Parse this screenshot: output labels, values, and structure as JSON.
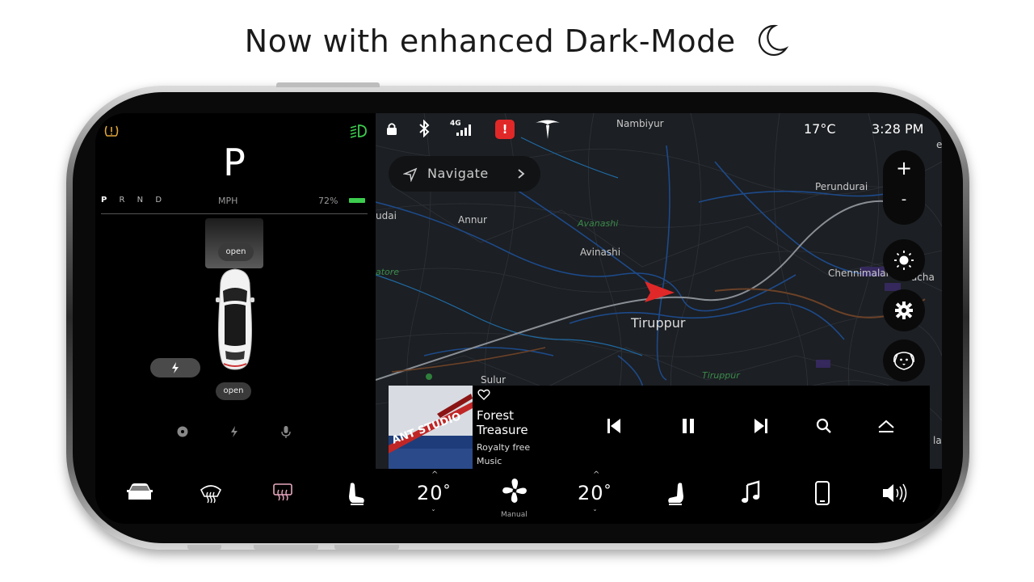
{
  "headline": "Now with enhanced Dark-Mode",
  "left_panel": {
    "gear": "P",
    "gears_rest": "R N D",
    "gear_selected": "P",
    "speed_unit": "MPH",
    "battery_percent": "72%",
    "battery_color": "#3ccd4e",
    "frunk_label": "open",
    "trunk_label": "open",
    "icons": [
      "tire-warning-icon",
      "headlights-icon",
      "charge-port-icon",
      "dashcam-icon",
      "lightning-icon",
      "microphone-icon"
    ]
  },
  "status_bar": {
    "icons": [
      "lock-icon",
      "bluetooth-icon",
      "lte-signal-icon",
      "alert-icon",
      "tesla-logo-icon"
    ],
    "network": "4G",
    "alert_mark": "!",
    "temperature": "17°C",
    "time": "3:28 PM"
  },
  "map": {
    "navigate_label": "Navigate",
    "zoom_in": "+",
    "zoom_out": "-",
    "places": {
      "nambiyur": "Nambiyur",
      "perundurai": "Perundurai",
      "annur": "Annur",
      "avanashi": "Avanashi",
      "avinashi": "Avinashi",
      "chennimalai": "Chennimalai",
      "tiruppur": "Tiruppur",
      "tiruppur_river": "Tiruppur",
      "sulur": "Sulur",
      "udai": "udai",
      "atore": "atore",
      "racha": "racha",
      "lai": "lai",
      "edge_e": "e"
    }
  },
  "media": {
    "title": "Forest Treasure",
    "subtitle": "Royalty free Music",
    "album_text": "ANT STUDIO"
  },
  "bottom_bar": {
    "driver_temp": "20",
    "passenger_temp": "20",
    "degree": "°",
    "fan_mode": "Manual",
    "up_caret": "^",
    "down_caret": "ˇ"
  }
}
